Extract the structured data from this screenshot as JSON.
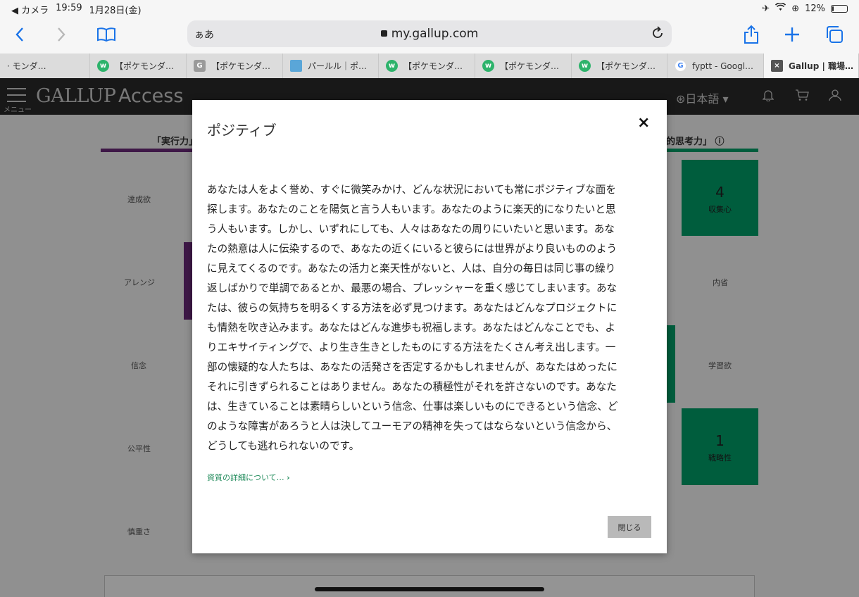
{
  "status": {
    "back_app": "◀ カメラ",
    "time": "19:59",
    "date": "1月28日(金)",
    "battery": "12%",
    "battery_level": 0.12
  },
  "toolbar": {
    "aa_label": "ぁあ",
    "host": "my.gallup.com"
  },
  "tabs": [
    {
      "label": "· モンダ…",
      "icon": "none",
      "color": ""
    },
    {
      "label": "【ポケモンダ…",
      "icon": "w",
      "color": "#2db36b"
    },
    {
      "label": "【ポケモンダ…",
      "icon": "G",
      "color": "#9a9a9a"
    },
    {
      "label": "パールル｜ポ…",
      "icon": "img",
      "color": "#5aa6d8"
    },
    {
      "label": "【ポケモンダ…",
      "icon": "w",
      "color": "#2db36b"
    },
    {
      "label": "【ポケモンダ…",
      "icon": "w",
      "color": "#2db36b"
    },
    {
      "label": "【ポケモンダ…",
      "icon": "w",
      "color": "#2db36b"
    },
    {
      "label": "fyptt - Googl…",
      "icon": "g",
      "color": "#4285f4"
    },
    {
      "label": "Gallup | 職場…",
      "icon": "x",
      "color": "#555555",
      "active": true
    }
  ],
  "site": {
    "menu_label": "メニュー",
    "brand": "GALLUP",
    "brand_suffix": "Access",
    "language": "日本語"
  },
  "background": {
    "left_section_title": "「実行力」",
    "right_section_title": "的思考力」",
    "left_color": "#6b2a7a",
    "right_color": "#00a06a",
    "left_labels": [
      "達成欲",
      "アレンジ",
      "信念",
      "公平性",
      "慎重さ"
    ],
    "right_labels": [
      "内省",
      "学習欲"
    ],
    "right_boxes": [
      {
        "rank": "4",
        "name": "収集心"
      },
      {
        "rank": "1",
        "name": "戦略性"
      }
    ]
  },
  "modal": {
    "title": "ポジティブ",
    "close_icon": "×",
    "body_lines": [
      "あなたは人をよく誉め、すぐに微笑みかけ、どんな状況においても常にポジティブな面を",
      "探します。あなたのことを陽気と言う人もいます。あなたのように楽天的になりたいと思",
      "う人もいます。しかし、いずれにしても、人々はあなたの周りにいたいと思います。あな",
      "たの熱意は人に伝染するので、あなたの近くにいると彼らには世界がより良いもののよう",
      "に見えてくるのです。あなたの活力と楽天性がないと、人は、自分の毎日は同じ事の繰り",
      "返しばかりで単調であるとか、最悪の場合、プレッシャーを重く感じてしまいます。あな",
      "たは、彼らの気持ちを明るくする方法を必ず見つけます。あなたはどんなプロジェクトに",
      "も情熱を吹き込みます。あなたはどんな進歩も祝福します。あなたはどんなことでも、よ",
      "りエキサイティングで、より生き生きとしたものにする方法をたくさん考え出します。一",
      "部の懐疑的な人たちは、あなたの活発さを否定するかもしれませんが、あなたはめったに",
      "それに引きずられることはありません。あなたの積極性がそれを許さないのです。あなた",
      "は、生きていることは素晴らしいという信念、仕事は楽しいものにできるという信念、ど",
      "のような障害があろうと人は決してユーモアの精神を失ってはならないという信念から、",
      "どうしても逃れられないのです。"
    ],
    "details_link": "資質の詳細について…",
    "close_button": "閉じる"
  }
}
